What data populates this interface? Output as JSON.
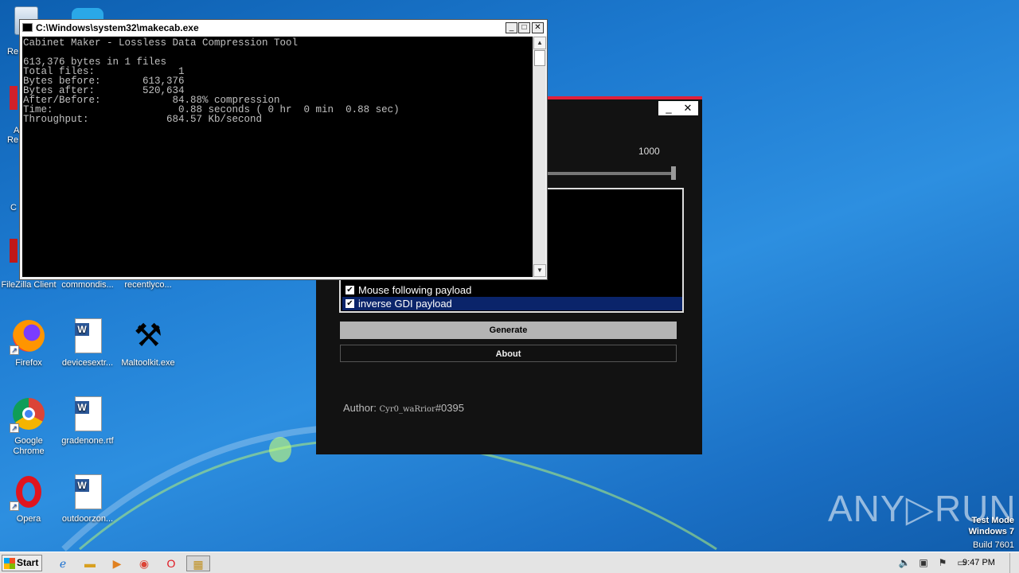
{
  "desktop": {
    "icons": [
      {
        "label": "FileZilla Client",
        "icon": "filezilla-icon"
      },
      {
        "label": "commondis...",
        "icon": "file-icon"
      },
      {
        "label": "recentlyco...",
        "icon": "file-icon"
      },
      {
        "label": "Firefox",
        "icon": "firefox-icon"
      },
      {
        "label": "devicesextr...",
        "icon": "word-doc-icon"
      },
      {
        "label": "Maltoolkit.exe",
        "icon": "tools-icon"
      },
      {
        "label": "Google Chrome",
        "icon": "chrome-icon"
      },
      {
        "label": "gradenone.rtf",
        "icon": "word-doc-icon"
      },
      {
        "label": "Opera",
        "icon": "opera-icon"
      },
      {
        "label": "outdoorzon...",
        "icon": "word-doc-icon"
      }
    ],
    "partial_labels": [
      "Re",
      "A",
      "Re",
      "C"
    ]
  },
  "cmd_window": {
    "title": "C:\\Windows\\system32\\makecab.exe",
    "lines": [
      "Cabinet Maker - Lossless Data Compression Tool",
      "",
      "613,376 bytes in 1 files",
      "Total files:              1",
      "Bytes before:       613,376",
      "Bytes after:        520,634",
      "After/Before:            84.88% compression",
      "Time:                     0.88 seconds ( 0 hr  0 min  0.88 sec)",
      "Throughput:             684.57 Kb/second"
    ],
    "minimize": "_",
    "maximize": "□",
    "close": "✕"
  },
  "generator_window": {
    "minimize": "_",
    "close": "✕",
    "slider_value": "1000",
    "slider_level": 1.0,
    "payloads": [
      {
        "label": "Mouse following payload",
        "checked": true,
        "selected": false
      },
      {
        "label": "inverse GDI payload",
        "checked": true,
        "selected": true
      }
    ],
    "generate_button": "Generate",
    "about_button": "About",
    "author_label": "Author: ",
    "author_name": "Cyr0_waRrior",
    "author_tag": "#0395"
  },
  "taskbar": {
    "start_label": "Start",
    "clock": "9:47 PM",
    "apps": [
      "ie-icon",
      "explorer-icon",
      "media-player-icon",
      "chrome-icon",
      "opera-icon",
      "makecab-icon"
    ]
  },
  "watermark": {
    "line1": "Test Mode",
    "line2": "Windows 7",
    "line3": "Build 7601",
    "brand": "ANY▷RUN"
  },
  "colors": {
    "accent_red": "#e0203a",
    "selection_blue": "#0a246a",
    "desktop_blue": "#1d7ad0"
  }
}
